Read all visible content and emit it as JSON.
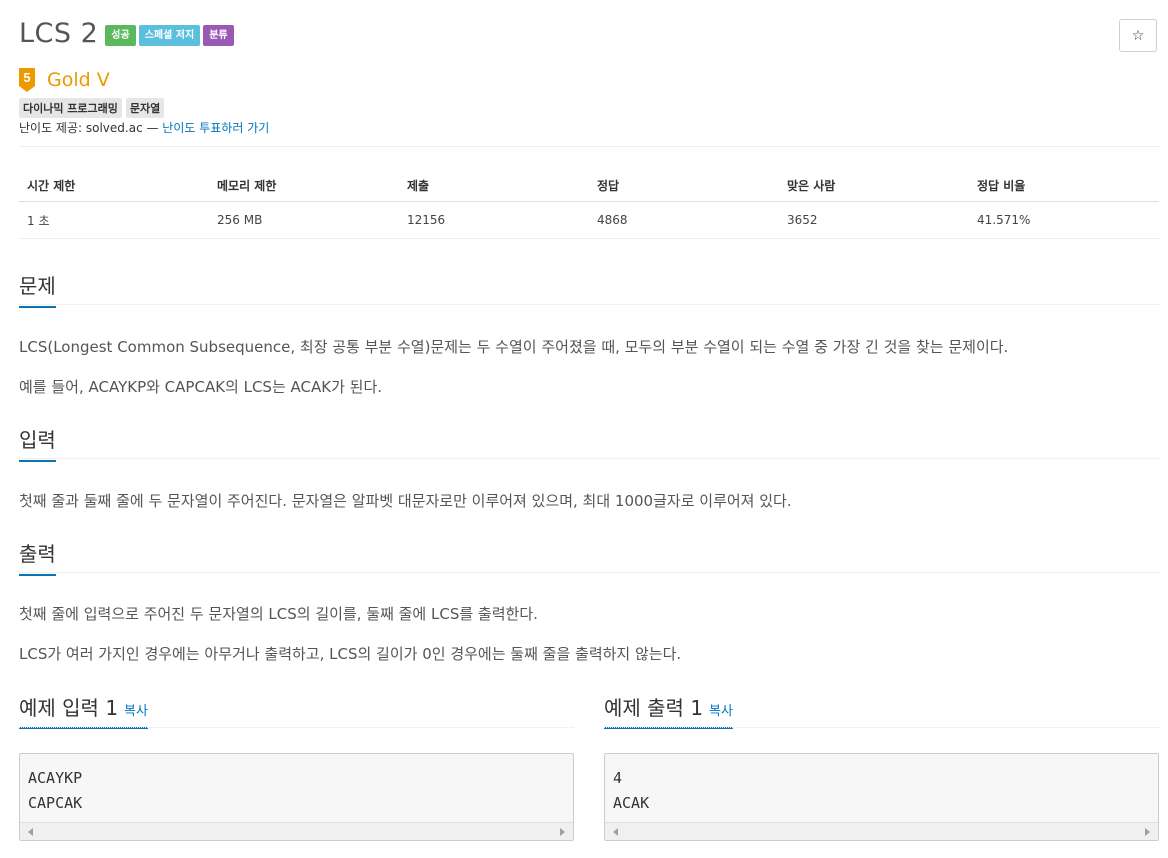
{
  "problem": {
    "title": "LCS 2",
    "badges": [
      {
        "label": "성공",
        "color": "#5cb85c"
      },
      {
        "label": "스페셜 저지",
        "color": "#5bc0de"
      },
      {
        "label": "분류",
        "color": "#9b59b6"
      }
    ],
    "star_icon": "☆"
  },
  "tier": {
    "number": "5",
    "label": "Gold V",
    "color": "#ec9a00"
  },
  "tags": [
    "다이나믹 프로그래밍",
    "문자열"
  ],
  "credit": {
    "prefix": "난이도 제공: solved.ac — ",
    "link": "난이도 투표하러 가기"
  },
  "stats": {
    "headers": [
      "시간 제한",
      "메모리 제한",
      "제출",
      "정답",
      "맞은 사람",
      "정답 비율"
    ],
    "values": [
      "1 초",
      "256 MB",
      "12156",
      "4868",
      "3652",
      "41.571%"
    ]
  },
  "sections": {
    "problem": {
      "title": "문제",
      "paragraphs": [
        "LCS(Longest Common Subsequence, 최장 공통 부분 수열)문제는 두 수열이 주어졌을 때, 모두의 부분 수열이 되는 수열 중 가장 긴 것을 찾는 문제이다.",
        "예를 들어, ACAYKP와 CAPCAK의 LCS는 ACAK가 된다."
      ]
    },
    "input": {
      "title": "입력",
      "paragraphs": [
        "첫째 줄과 둘째 줄에 두 문자열이 주어진다. 문자열은 알파벳 대문자로만 이루어져 있으며, 최대 1000글자로 이루어져 있다."
      ]
    },
    "output": {
      "title": "출력",
      "paragraphs": [
        "첫째 줄에 입력으로 주어진 두 문자열의 LCS의 길이를, 둘째 줄에 LCS를 출력한다.",
        "LCS가 여러 가지인 경우에는 아무거나 출력하고, LCS의 길이가 0인 경우에는 둘째 줄을 출력하지 않는다."
      ]
    }
  },
  "examples": {
    "input": {
      "title": "예제 입력 1",
      "copy": "복사",
      "content": "ACAYKP\nCAPCAK"
    },
    "output": {
      "title": "예제 출력 1",
      "copy": "복사",
      "content": "4\nACAK"
    }
  }
}
